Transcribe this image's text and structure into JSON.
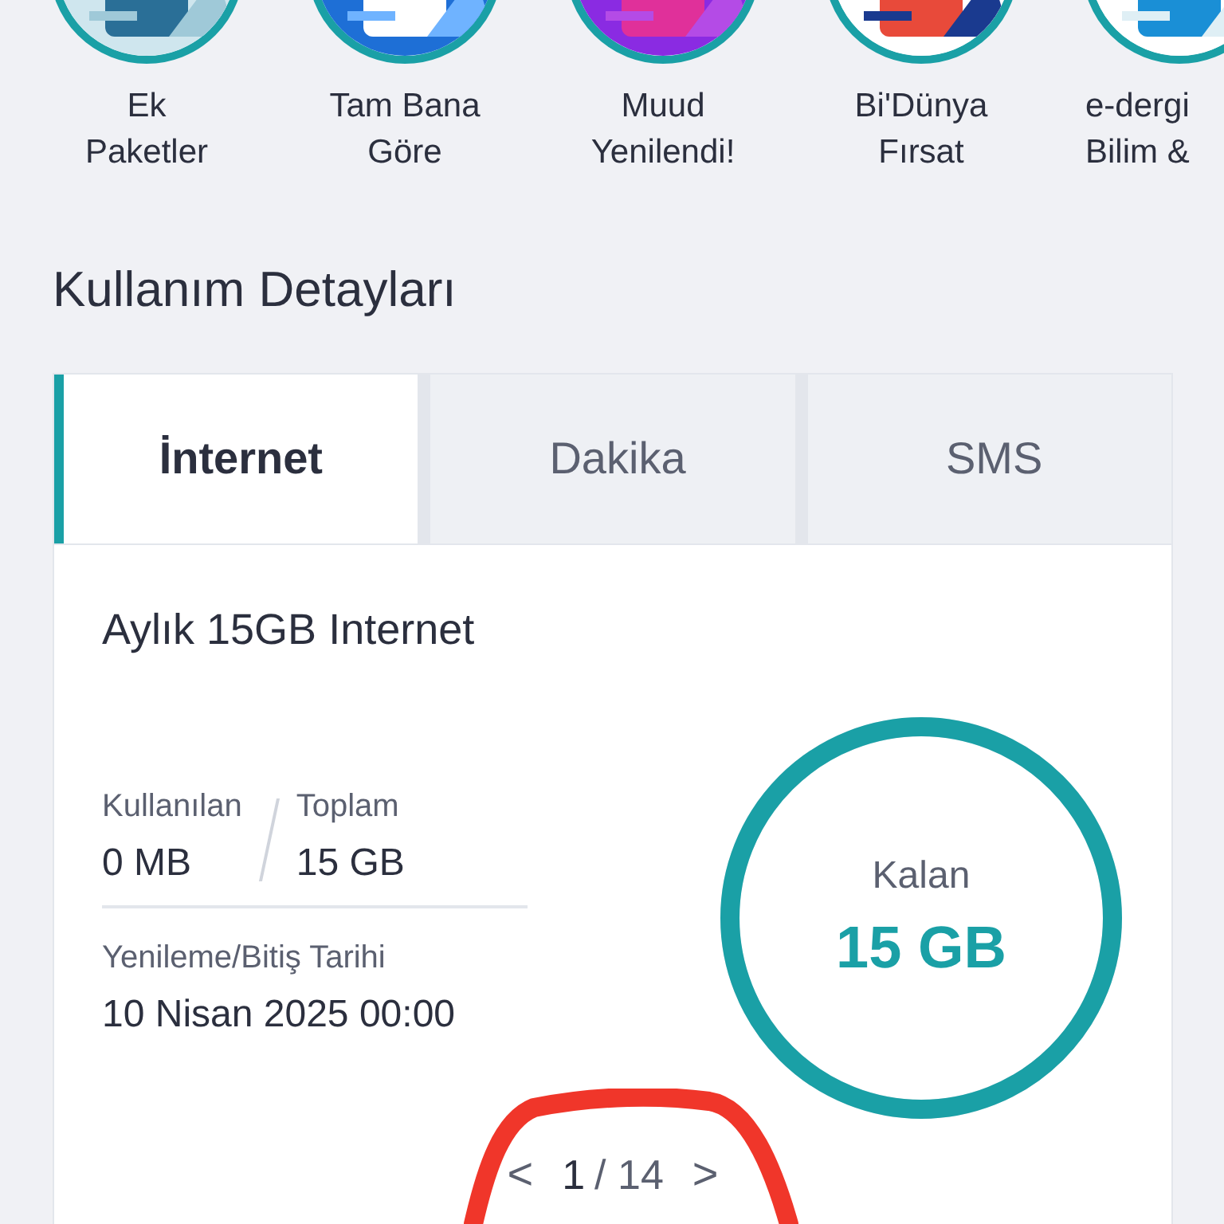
{
  "stories": [
    {
      "lines": [
        "Ek",
        "Paketler"
      ]
    },
    {
      "lines": [
        "Tam Bana",
        "Göre"
      ]
    },
    {
      "lines": [
        "Muud",
        "Yenilendi!"
      ]
    },
    {
      "lines": [
        "Bi'Dünya",
        "Fırsat"
      ]
    },
    {
      "lines": [
        "e-dergi",
        "Bilim &"
      ]
    }
  ],
  "section_title": "Kullanım Detayları",
  "tabs": [
    {
      "label": "İnternet",
      "selected": true
    },
    {
      "label": "Dakika",
      "selected": false
    },
    {
      "label": "SMS",
      "selected": false
    }
  ],
  "package": {
    "title": "Aylık 15GB Internet",
    "used_label": "Kullanılan",
    "used_value": "0 MB",
    "total_label": "Toplam",
    "total_value": "15 GB",
    "renew_label": "Yenileme/Bitiş Tarihi",
    "renew_value": "10 Nisan 2025 00:00",
    "remaining_label": "Kalan",
    "remaining_value": "15 GB",
    "level": 1
  },
  "pager": {
    "prev": "<",
    "current": "1",
    "total": "/ 14",
    "next": ">"
  }
}
